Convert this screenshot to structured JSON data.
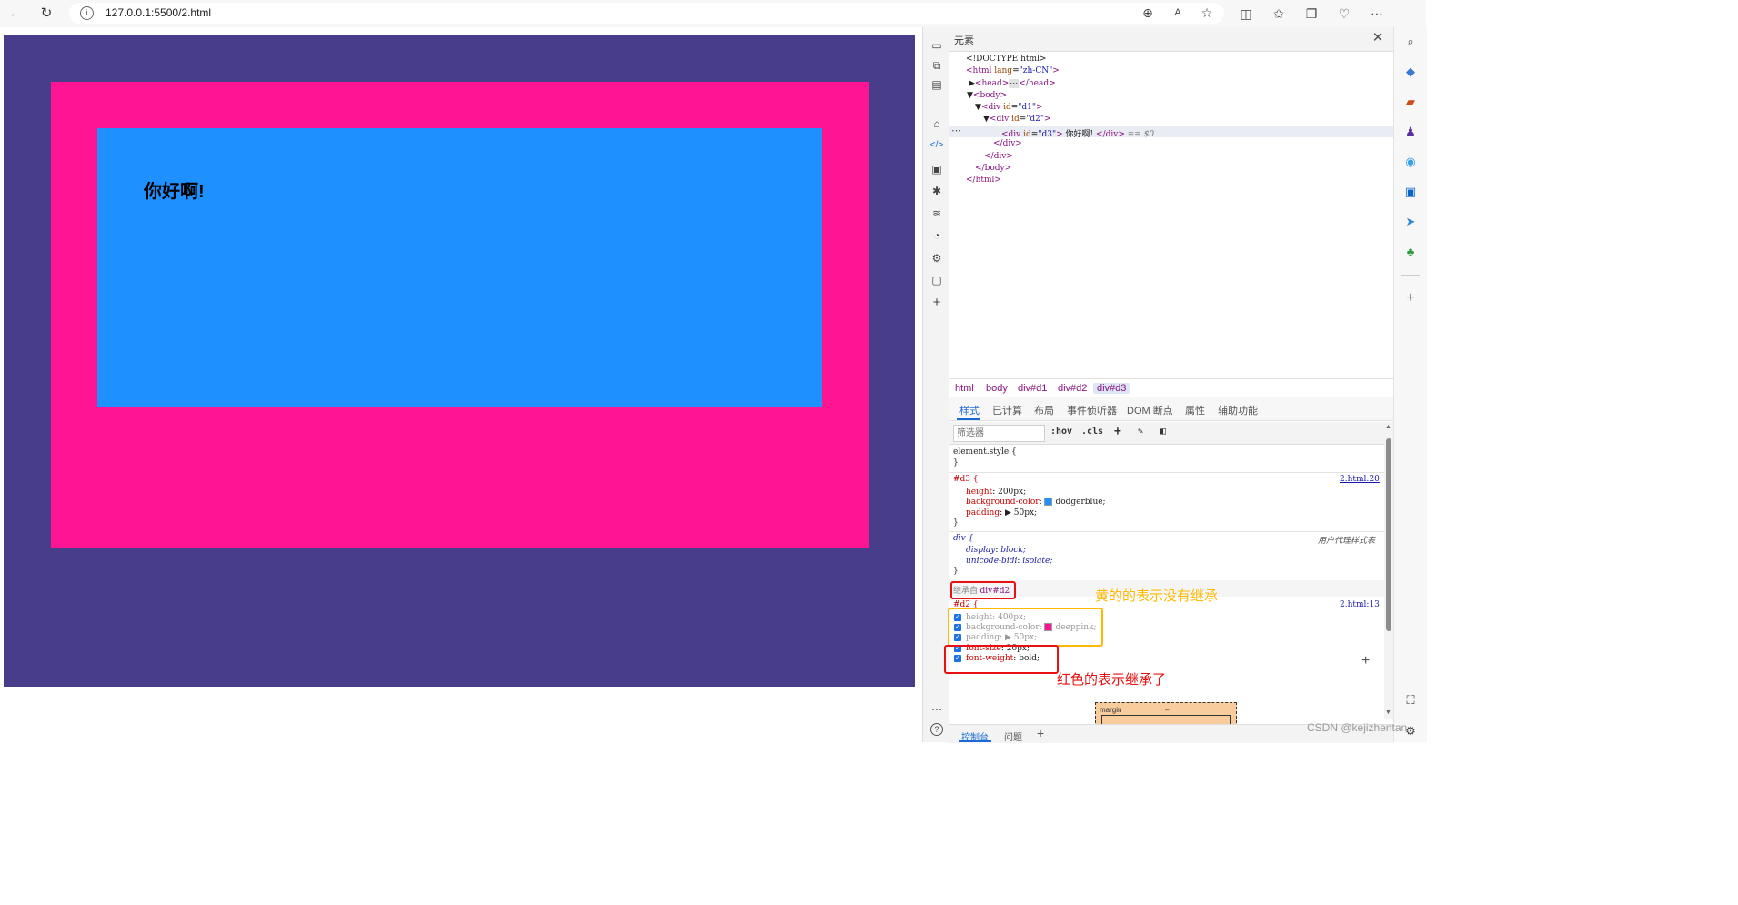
{
  "browser": {
    "url": "127.0.0.1:5500/2.html",
    "icons": [
      "back-arrow-icon",
      "reload-icon",
      "info-icon",
      "zoom-icon",
      "read-aloud-icon",
      "favorite-star-icon",
      "split-screen-icon",
      "favorites-icon",
      "collections-icon",
      "browser-essentials-icon",
      "more-icon"
    ]
  },
  "page": {
    "d3_text": "你好啊!",
    "colors": {
      "d1": "#483d8b",
      "d2": "#ff1493",
      "d3": "#1e90ff"
    }
  },
  "devtools": {
    "title": "元素",
    "dom": {
      "doctype": "<!DOCTYPE html>",
      "html_open_tag": "<html",
      "html_attr": "lang",
      "html_attr_value": "\"zh-CN\"",
      "head_open": "<head>",
      "ellipsis": "⋯",
      "head_close": "</head>",
      "body_open": "<body>",
      "div_open": "<div",
      "id_attr": "id",
      "d1_value": "\"d1\"",
      "d2_value": "\"d2\"",
      "d3_value": "\"d3\"",
      "tag_end": ">",
      "d3_text": "你好啊!",
      "div_close": "</div>",
      "eq0": "== $0",
      "body_close": "</body>",
      "html_close": "</html>"
    },
    "breadcrumb": [
      "html",
      "body",
      "div#d1",
      "div#d2",
      "div#d3"
    ],
    "subtabs": [
      "样式",
      "已计算",
      "布局",
      "事件侦听器",
      "DOM 断点",
      "属性",
      "辅助功能"
    ],
    "filter_placeholder": "筛选器",
    "filter_buttons": [
      ":hov",
      ".cls"
    ],
    "styles": {
      "element_style": "element.style {",
      "close_brace": "}",
      "d3_selector": "#d3 {",
      "d3_source": "2.html:20",
      "d3_props": [
        {
          "name": "height",
          "value": "200px;"
        },
        {
          "name": "background-color",
          "value": "dodgerblue;",
          "swatch": "#1e90ff"
        },
        {
          "name": "padding",
          "value": "50px;"
        }
      ],
      "ua_selector": "div {",
      "ua_source": "用户代理样式表",
      "ua_props": [
        {
          "name": "display",
          "value": "block;"
        },
        {
          "name": "unicode-bidi",
          "value": "isolate;"
        }
      ],
      "inherited_label": "继承自",
      "inherited_from": "div#d2",
      "d2_selector": "#d2 {",
      "d2_source": "2.html:13",
      "d2_props": [
        {
          "name": "height",
          "value": "400px;"
        },
        {
          "name": "background-color",
          "value": "deeppink;",
          "swatch": "#ff1493"
        },
        {
          "name": "padding",
          "value": "50px;"
        },
        {
          "name": "font-size",
          "value": "20px;"
        },
        {
          "name": "font-weight",
          "value": "bold;"
        }
      ],
      "prop_sep": ": "
    },
    "annotations": {
      "yellow_note": "黄的的表示没有继承",
      "red_note": "红色的表示继承了",
      "yellow_color": "#ffb900",
      "red_color": "#e81010"
    },
    "boxmodel": {
      "label": "margin",
      "value": "–"
    },
    "drawer_tabs": [
      "控制台",
      "问题"
    ]
  },
  "watermark": "CSDN @kejizhentan"
}
